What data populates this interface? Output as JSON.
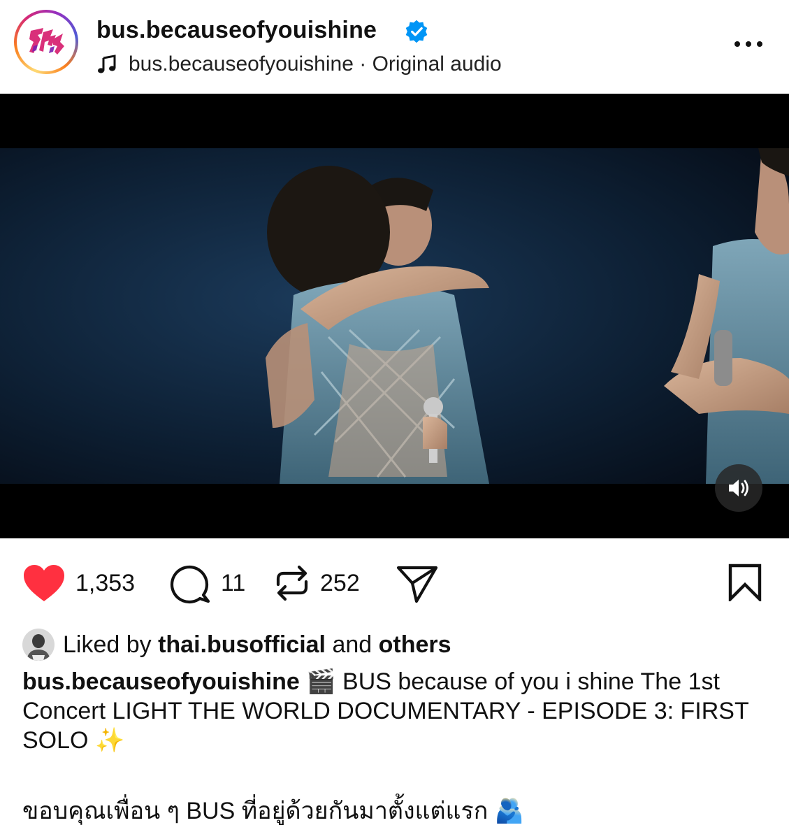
{
  "post": {
    "username": "bus.becauseofyouishine",
    "audio_owner": "bus.becauseofyouishine",
    "audio_separator": " · ",
    "audio_label": "Original audio"
  },
  "actions": {
    "likes_count": "1,353",
    "comments_count": "11",
    "reposts_count": "252"
  },
  "liked_by": {
    "prefix": "Liked by ",
    "user": "thai.busofficial",
    "middle": " and ",
    "others": "others"
  },
  "caption": {
    "author": "bus.becauseofyouishine",
    "clapper_emoji": "🎬",
    "text": "BUS because of you i shine The 1st Concert LIGHT THE WORLD DOCUMENTARY - EPISODE 3: FIRST SOLO",
    "sparkle_emoji": "✨",
    "thai_line": "ขอบคุณเพื่อน ๆ BUS ที่อยู่ด้วยกันมาตั้งแต่แรก",
    "hug_emoji": "🫂"
  },
  "colors": {
    "like_red": "#ff3040",
    "verified_blue": "#0095f6",
    "video_bg": "#000000"
  }
}
